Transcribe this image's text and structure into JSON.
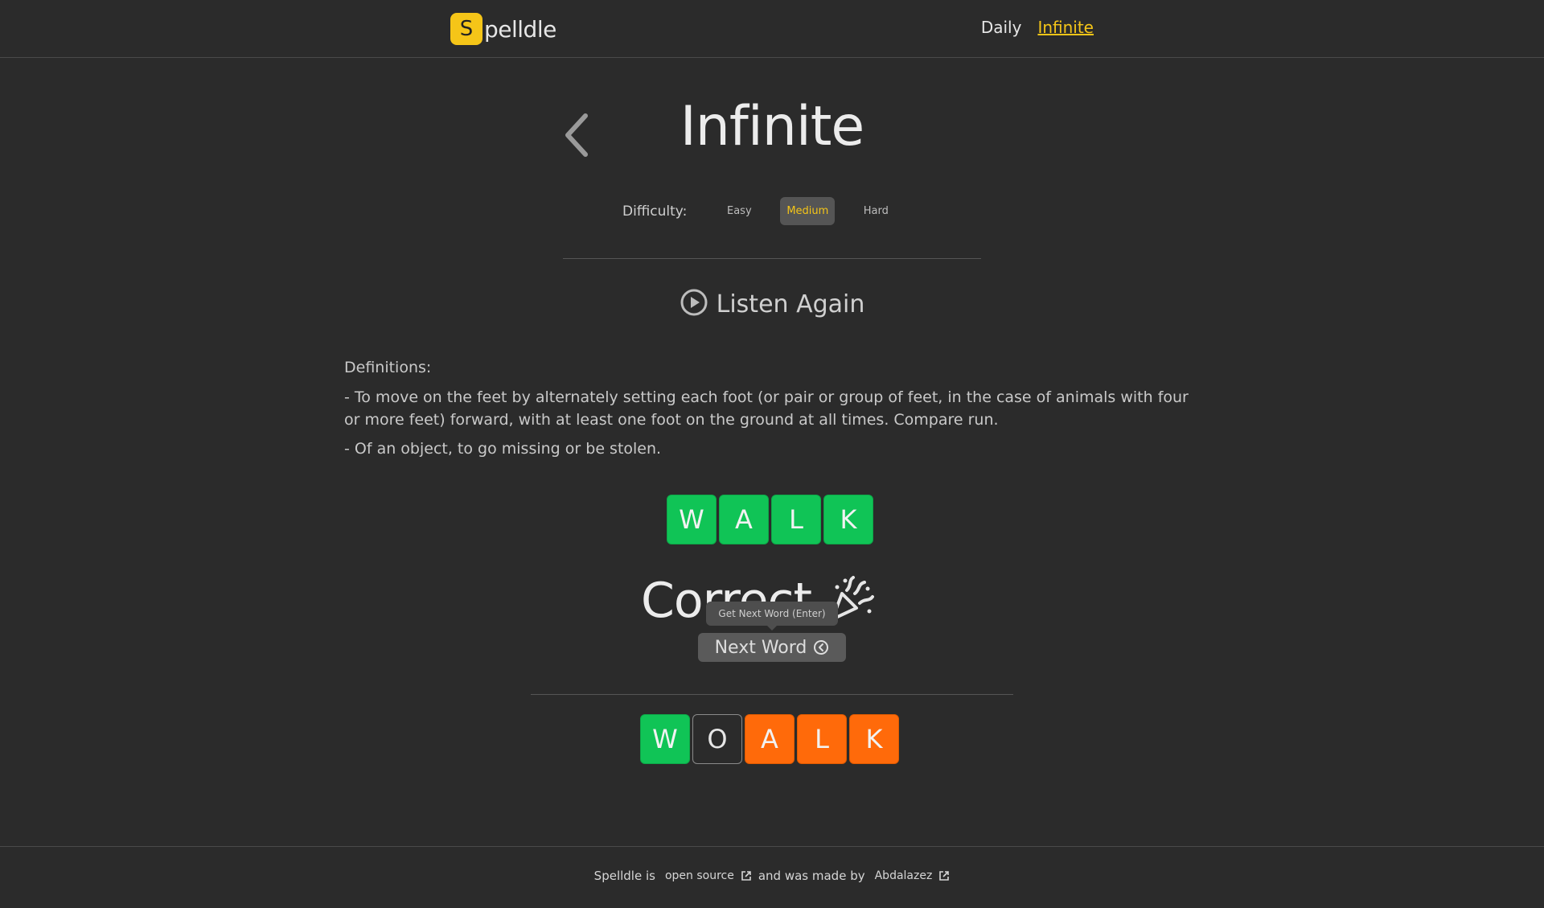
{
  "header": {
    "logo_letter": "S",
    "logo_text": "pelldle",
    "nav": {
      "daily": "Daily",
      "infinite": "Infinite"
    }
  },
  "main": {
    "title": "Infinite",
    "difficulty": {
      "label": "Difficulty:",
      "options": [
        "Easy",
        "Medium",
        "Hard"
      ],
      "selected": "Medium"
    },
    "listen_again": "Listen Again",
    "definitions": {
      "title": "Definitions:",
      "items": [
        "- To move on the feet by alternately setting each foot (or pair or group of feet, in the case of animals with four or more feet) forward, with at least one foot on the ground at all times. Compare run.",
        "- Of an object, to go missing or be stolen."
      ]
    },
    "answer_tiles": [
      "W",
      "A",
      "L",
      "K"
    ],
    "result": "Correct",
    "tooltip": "Get Next Word (Enter)",
    "next_word": "Next Word",
    "guess_tiles": [
      {
        "letter": "W",
        "state": "correct"
      },
      {
        "letter": "O",
        "state": "absent"
      },
      {
        "letter": "A",
        "state": "present"
      },
      {
        "letter": "L",
        "state": "present"
      },
      {
        "letter": "K",
        "state": "present"
      }
    ]
  },
  "footer": {
    "prefix": "Spelldle is",
    "open_source": "open source",
    "middle": "and was made by",
    "author": "Abdalazez"
  },
  "colors": {
    "background": "#2b2b2b",
    "accent": "#f5c518",
    "correct": "#10c456",
    "present": "#ff6a0a"
  }
}
